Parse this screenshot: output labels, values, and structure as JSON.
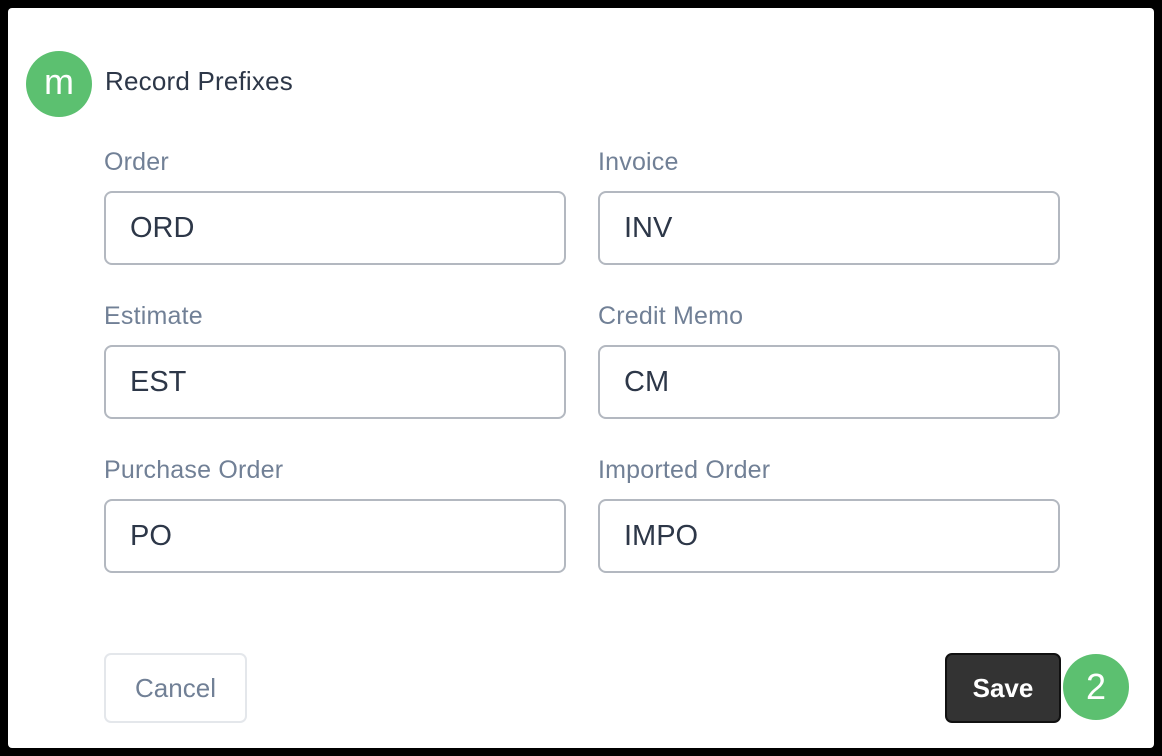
{
  "badges": {
    "start_letter": "m",
    "step_number": "2"
  },
  "header": {
    "title": "Record Prefixes"
  },
  "fields": {
    "order": {
      "label": "Order",
      "value": "ORD"
    },
    "invoice": {
      "label": "Invoice",
      "value": "INV"
    },
    "estimate": {
      "label": "Estimate",
      "value": "EST"
    },
    "credit_memo": {
      "label": "Credit Memo",
      "value": "CM"
    },
    "purchase_order": {
      "label": "Purchase Order",
      "value": "PO"
    },
    "imported_order": {
      "label": "Imported Order",
      "value": "IMPO"
    }
  },
  "actions": {
    "cancel_label": "Cancel",
    "save_label": "Save"
  },
  "colors": {
    "badge_green": "#5cc070",
    "save_button_bg": "#333333",
    "label_gray": "#718096",
    "text_dark": "#2d3748"
  }
}
